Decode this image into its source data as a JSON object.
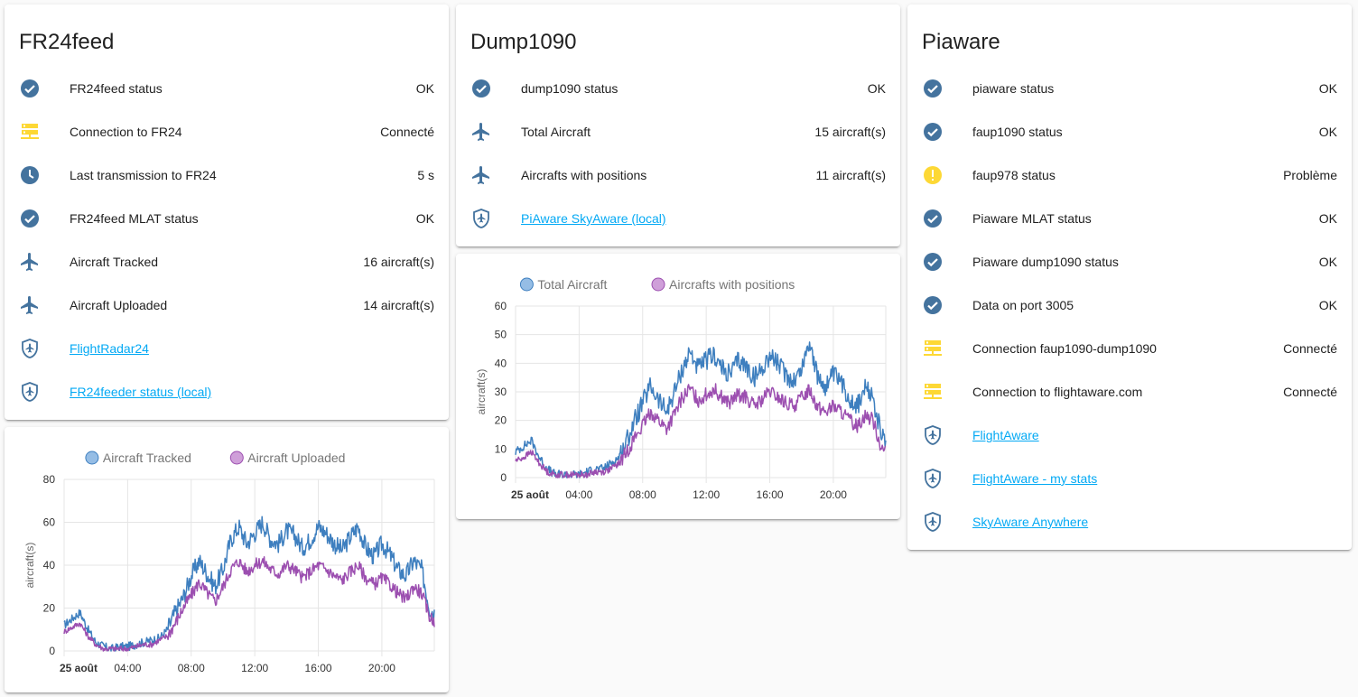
{
  "colors": {
    "icon_blue": "#44739e",
    "icon_yellow": "#fdd835",
    "link": "#03a9f4",
    "series_blue": "#3e7fbf",
    "series_purple": "#9c4fb0",
    "legend_blue": "#95bde5",
    "legend_purple": "#cf9fd9"
  },
  "fr24": {
    "title": "FR24feed",
    "rows": [
      {
        "icon": "check-circle-icon",
        "label": "FR24feed status",
        "value": "OK"
      },
      {
        "icon": "server-network-icon",
        "label": "Connection to FR24",
        "value": "Connecté"
      },
      {
        "icon": "clock-icon",
        "label": "Last transmission to FR24",
        "value": "5 s"
      },
      {
        "icon": "check-circle-icon",
        "label": "FR24feed MLAT status",
        "value": "OK"
      },
      {
        "icon": "airplane-icon",
        "label": "Aircraft Tracked",
        "value": "16 aircraft(s)"
      },
      {
        "icon": "airplane-icon",
        "label": "Aircraft Uploaded",
        "value": "14 aircraft(s)"
      },
      {
        "icon": "shield-airplane-icon",
        "label": "FlightRadar24",
        "link": true
      },
      {
        "icon": "shield-airplane-icon",
        "label": "FR24feeder status (local)",
        "link": true
      }
    ]
  },
  "dump1090": {
    "title": "Dump1090",
    "rows": [
      {
        "icon": "check-circle-icon",
        "label": "dump1090 status",
        "value": "OK"
      },
      {
        "icon": "airplane-icon",
        "label": "Total Aircraft",
        "value": "15 aircraft(s)"
      },
      {
        "icon": "airplane-icon",
        "label": "Aircrafts with positions",
        "value": "11 aircraft(s)"
      },
      {
        "icon": "shield-airplane-icon",
        "label": "PiAware SkyAware (local)",
        "link": true
      }
    ]
  },
  "piaware": {
    "title": "Piaware",
    "rows": [
      {
        "icon": "check-circle-icon",
        "label": "piaware status",
        "value": "OK"
      },
      {
        "icon": "check-circle-icon",
        "label": "faup1090 status",
        "value": "OK"
      },
      {
        "icon": "alert-circle-icon",
        "label": "faup978 status",
        "value": "Problème"
      },
      {
        "icon": "check-circle-icon",
        "label": "Piaware MLAT status",
        "value": "OK"
      },
      {
        "icon": "check-circle-icon",
        "label": "Piaware dump1090 status",
        "value": "OK"
      },
      {
        "icon": "check-circle-icon",
        "label": "Data on port 3005",
        "value": "OK"
      },
      {
        "icon": "server-network-icon",
        "label": "Connection faup1090-dump1090",
        "value": "Connecté"
      },
      {
        "icon": "server-network-icon",
        "label": "Connection to flightaware.com",
        "value": "Connecté"
      },
      {
        "icon": "shield-airplane-icon",
        "label": "FlightAware",
        "link": true
      },
      {
        "icon": "shield-airplane-icon",
        "label": "FlightAware - my stats",
        "link": true
      },
      {
        "icon": "shield-airplane-icon",
        "label": "SkyAware Anywhere",
        "link": true
      }
    ]
  },
  "chart_data": [
    {
      "id": "fr24-chart",
      "type": "line",
      "ylabel": "aircraft(s)",
      "ylim": [
        0,
        80
      ],
      "yticks": [
        0,
        20,
        40,
        60,
        80
      ],
      "xticks": [
        "25 août",
        "04:00",
        "08:00",
        "12:00",
        "16:00",
        "20:00"
      ],
      "xhours": [
        0,
        4,
        8,
        12,
        16,
        20
      ],
      "xrange_hours": [
        0,
        23.3
      ],
      "grid": true,
      "legend_position": "top-center",
      "series": [
        {
          "name": "Aircraft Tracked",
          "color_key": "series_blue",
          "legend_key": "legend_blue",
          "hours": [
            0,
            0.5,
            1,
            1.5,
            2,
            2.5,
            3,
            3.5,
            4,
            4.5,
            5,
            5.5,
            6,
            6.5,
            7,
            7.5,
            8,
            8.5,
            9,
            9.5,
            10,
            10.5,
            11,
            11.5,
            12,
            12.5,
            13,
            13.5,
            14,
            14.5,
            15,
            15.5,
            16,
            16.5,
            17,
            17.5,
            18,
            18.5,
            19,
            19.5,
            20,
            20.5,
            21,
            21.5,
            22,
            22.5,
            23,
            23.3
          ],
          "values": [
            12,
            15,
            18,
            10,
            4,
            2,
            1,
            2,
            2,
            3,
            4,
            5,
            6,
            10,
            18,
            25,
            35,
            42,
            36,
            30,
            38,
            52,
            58,
            50,
            55,
            60,
            52,
            50,
            56,
            54,
            48,
            52,
            58,
            55,
            50,
            47,
            53,
            58,
            48,
            44,
            50,
            45,
            38,
            35,
            42,
            38,
            20,
            18
          ],
          "noise": 9
        },
        {
          "name": "Aircraft Uploaded",
          "color_key": "series_purple",
          "legend_key": "legend_purple",
          "hours": [
            0,
            0.5,
            1,
            1.5,
            2,
            2.5,
            3,
            3.5,
            4,
            4.5,
            5,
            5.5,
            6,
            6.5,
            7,
            7.5,
            8,
            8.5,
            9,
            9.5,
            10,
            10.5,
            11,
            11.5,
            12,
            12.5,
            13,
            13.5,
            14,
            14.5,
            15,
            15.5,
            16,
            16.5,
            17,
            17.5,
            18,
            18.5,
            19,
            19.5,
            20,
            20.5,
            21,
            21.5,
            22,
            22.5,
            23,
            23.3
          ],
          "values": [
            9,
            11,
            13,
            7,
            3,
            1,
            1,
            1,
            1,
            2,
            3,
            3,
            5,
            7,
            13,
            20,
            26,
            32,
            27,
            23,
            30,
            38,
            42,
            37,
            40,
            42,
            38,
            36,
            40,
            38,
            34,
            37,
            40,
            38,
            35,
            33,
            37,
            40,
            34,
            31,
            34,
            31,
            27,
            24,
            30,
            27,
            16,
            14
          ],
          "noise": 6
        }
      ]
    },
    {
      "id": "dump-chart",
      "type": "line",
      "ylabel": "aircraft(s)",
      "ylim": [
        0,
        60
      ],
      "yticks": [
        0,
        10,
        20,
        30,
        40,
        50,
        60
      ],
      "xticks": [
        "25 août",
        "04:00",
        "08:00",
        "12:00",
        "16:00",
        "20:00"
      ],
      "xhours": [
        0,
        4,
        8,
        12,
        16,
        20
      ],
      "xrange_hours": [
        0,
        23.3
      ],
      "grid": true,
      "legend_position": "top-center",
      "series": [
        {
          "name": "Total Aircraft",
          "color_key": "series_blue",
          "legend_key": "legend_blue",
          "hours": [
            0,
            0.5,
            1,
            1.5,
            2,
            2.5,
            3,
            3.5,
            4,
            4.5,
            5,
            5.5,
            6,
            6.5,
            7,
            7.5,
            8,
            8.5,
            9,
            9.5,
            10,
            10.5,
            11,
            11.5,
            12,
            12.5,
            13,
            13.5,
            14,
            14.5,
            15,
            15.5,
            16,
            16.5,
            17,
            17.5,
            18,
            18.5,
            19,
            19.5,
            20,
            20.5,
            21,
            21.5,
            22,
            22.5,
            23,
            23.3
          ],
          "values": [
            9,
            11,
            13,
            7,
            3,
            1,
            1,
            1,
            1,
            2,
            3,
            3,
            5,
            7,
            13,
            20,
            26,
            32,
            27,
            23,
            30,
            38,
            44,
            38,
            41,
            43,
            38,
            36,
            41,
            39,
            35,
            38,
            43,
            40,
            36,
            34,
            38,
            48,
            35,
            32,
            36,
            33,
            28,
            25,
            31,
            28,
            15,
            13
          ],
          "noise": 7
        },
        {
          "name": "Aircrafts with positions",
          "color_key": "series_purple",
          "legend_key": "legend_purple",
          "hours": [
            0,
            0.5,
            1,
            1.5,
            2,
            2.5,
            3,
            3.5,
            4,
            4.5,
            5,
            5.5,
            6,
            6.5,
            7,
            7.5,
            8,
            8.5,
            9,
            9.5,
            10,
            10.5,
            11,
            11.5,
            12,
            12.5,
            13,
            13.5,
            14,
            14.5,
            15,
            15.5,
            16,
            16.5,
            17,
            17.5,
            18,
            18.5,
            19,
            19.5,
            20,
            20.5,
            21,
            21.5,
            22,
            22.5,
            23,
            23.3
          ],
          "values": [
            6,
            7,
            9,
            5,
            2,
            1,
            1,
            1,
            1,
            1,
            2,
            2,
            3,
            5,
            9,
            14,
            18,
            23,
            20,
            17,
            22,
            28,
            31,
            27,
            29,
            31,
            28,
            26,
            29,
            28,
            25,
            27,
            30,
            28,
            26,
            25,
            28,
            31,
            25,
            23,
            25,
            23,
            20,
            18,
            22,
            20,
            11,
            9
          ],
          "noise": 5
        }
      ]
    }
  ]
}
